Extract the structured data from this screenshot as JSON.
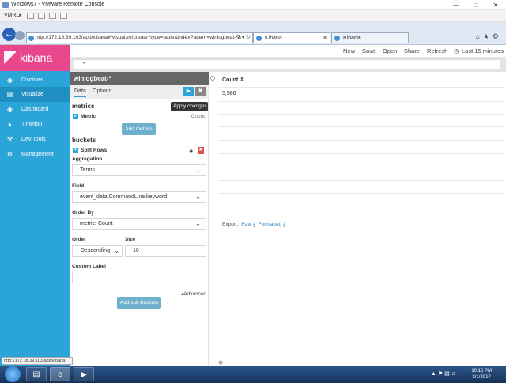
{
  "window": {
    "title": "Windows7 - VMware Remote Console",
    "vmrc_label": "VMRC"
  },
  "browser": {
    "url": "http://172.18.39.103/app/kibana#/visualize/create?type=table&indexPattern=winlogbeat-*&",
    "tabs": [
      {
        "label": "Kibana"
      },
      {
        "label": "Kibana"
      }
    ],
    "status_url": "http://172.18.39.103/app/kibana"
  },
  "sidebar": {
    "brand": "kibana",
    "items": [
      {
        "label": "Discover",
        "icon": "compass-icon"
      },
      {
        "label": "Visualize",
        "icon": "bar-chart-icon"
      },
      {
        "label": "Dashboard",
        "icon": "dashboard-icon"
      },
      {
        "label": "Timelion",
        "icon": "shield-icon"
      },
      {
        "label": "Dev Tools",
        "icon": "wrench-icon"
      },
      {
        "label": "Management",
        "icon": "gear-icon"
      }
    ],
    "active_index": 1
  },
  "header": {
    "menu": [
      "New",
      "Save",
      "Open",
      "Share",
      "Refresh"
    ],
    "time_range": "Last 15 minutes",
    "query": "*"
  },
  "editor": {
    "index_pattern": "winlogbeat-*",
    "tabs": [
      "Data",
      "Options"
    ],
    "tooltip": "Apply changes",
    "metrics_heading": "metrics",
    "metric_label": "Metric",
    "metric_value": "Count",
    "add_metrics": "Add metrics",
    "buckets_heading": "buckets",
    "split_rows": "Split Rows",
    "aggregation_label": "Aggregation",
    "aggregation_value": "Terms",
    "field_label": "Field",
    "field_value": "event_data.CommandLine.keyword",
    "orderby_label": "Order By",
    "orderby_value": "metric: Count",
    "order_label": "Order",
    "order_value": "Descending",
    "size_label": "Size",
    "size_value": "10",
    "custom_label": "Custom Label",
    "custom_value": "",
    "advanced": "Advanced",
    "add_sub_buckets": "Add sub-buckets"
  },
  "results": {
    "column": "Count",
    "values": [
      "5,586"
    ],
    "export_label": "Export:",
    "raw": "Raw",
    "formatted": "Formatted"
  },
  "taskbar": {
    "time": "10:16 PM",
    "date": "3/1/2017"
  }
}
